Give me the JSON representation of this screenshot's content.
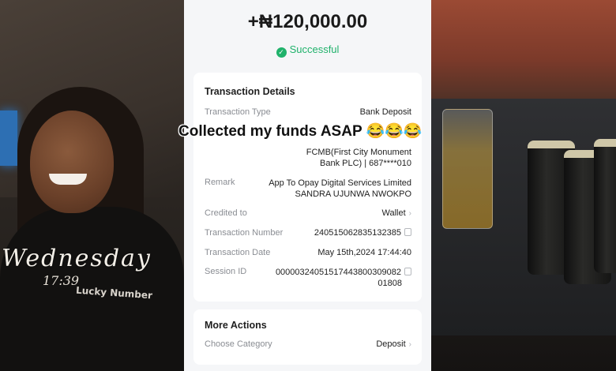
{
  "left_overlay": {
    "day": "Wednesday",
    "time": "17:39",
    "shirt_text": "Lucky Number"
  },
  "receipt": {
    "amount": "+₦120,000.00",
    "status": "Successful",
    "details_title": "Transaction Details",
    "rows": [
      {
        "label": "Transaction Type",
        "value": "Bank Deposit"
      },
      {
        "label": "",
        "value": "FCMB(First City Monument\nBank PLC) | 687****010"
      },
      {
        "label": "Remark",
        "value": "App To Opay Digital Services Limited\nSANDRA UJUNWA NWOKPO"
      },
      {
        "label": "Credited to",
        "value": "Wallet"
      },
      {
        "label": "Transaction Number",
        "value": "240515062835132385"
      },
      {
        "label": "Transaction Date",
        "value": "May 15th,2024 17:44:40"
      },
      {
        "label": "Session ID",
        "value": "000003240515174438003098201808"
      }
    ],
    "session_line1": "00000324051517443800309082",
    "session_line2": "01808",
    "fcmb_line1": "FCMB(First City Monument",
    "fcmb_line2": "Bank PLC) | 687****010",
    "remark_line1": "App To Opay Digital Services Limited",
    "remark_line2": "SANDRA UJUNWA NWOKPO",
    "more_actions_title": "More Actions",
    "choose_category_label": "Choose Category",
    "choose_category_value": "Deposit"
  },
  "caption": "Collected my funds ASAP 😂😂😂",
  "colors": {
    "success": "#20b26b",
    "receipt_bg": "#f5f6f8"
  }
}
